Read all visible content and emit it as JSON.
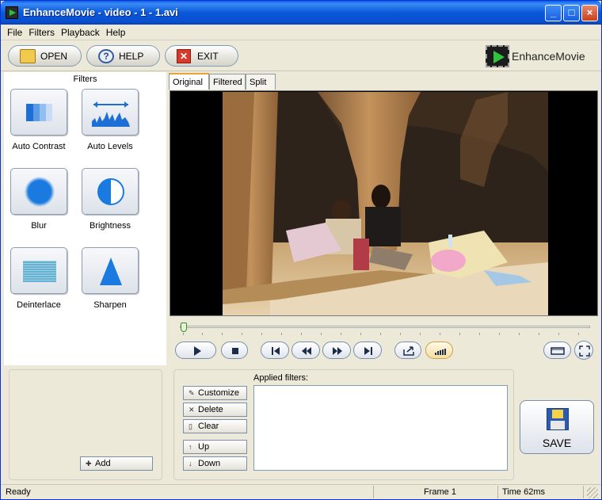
{
  "window": {
    "title": "EnhanceMovie - video - 1 - 1.avi",
    "min": "_",
    "max": "□",
    "close": "×"
  },
  "menu": [
    "File",
    "Filters",
    "Playback",
    "Help"
  ],
  "toolbar": {
    "open": "OPEN",
    "help": "HELP",
    "exit": "EXIT",
    "brand": "EnhanceMovie"
  },
  "filters": {
    "header": "Filters",
    "items": [
      {
        "label": "Auto Contrast",
        "icon": "auto-contrast-icon"
      },
      {
        "label": "Auto Levels",
        "icon": "auto-levels-icon"
      },
      {
        "label": "Blur",
        "icon": "blur-icon"
      },
      {
        "label": "Brightness",
        "icon": "brightness-icon"
      },
      {
        "label": "Deinterlace",
        "icon": "deinterlace-icon"
      },
      {
        "label": "Sharpen",
        "icon": "sharpen-icon"
      }
    ],
    "add": "Add"
  },
  "tabs": [
    "Original",
    "Filtered",
    "Split"
  ],
  "active_tab": "Original",
  "playback": {
    "position_fraction": 0.0
  },
  "applied": {
    "label": "Applied filters:",
    "customize": "Customize",
    "delete": "Delete",
    "clear": "Clear",
    "up": "Up",
    "down": "Down",
    "items": []
  },
  "save": "SAVE",
  "status": {
    "state": "Ready",
    "frame": "Frame 1",
    "time": "Time 62ms"
  },
  "colors": {
    "title_bar": "#0a58d9",
    "accent_blue": "#1a7ae0",
    "chrome": "#ece9d8"
  }
}
